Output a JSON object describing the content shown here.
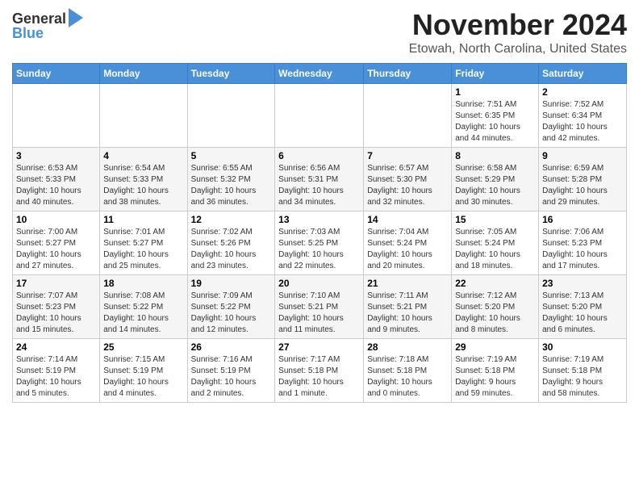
{
  "logo": {
    "text_general": "General",
    "text_blue": "Blue"
  },
  "header": {
    "month": "November 2024",
    "location": "Etowah, North Carolina, United States"
  },
  "weekdays": [
    "Sunday",
    "Monday",
    "Tuesday",
    "Wednesday",
    "Thursday",
    "Friday",
    "Saturday"
  ],
  "weeks": [
    [
      {
        "day": "",
        "info": ""
      },
      {
        "day": "",
        "info": ""
      },
      {
        "day": "",
        "info": ""
      },
      {
        "day": "",
        "info": ""
      },
      {
        "day": "",
        "info": ""
      },
      {
        "day": "1",
        "info": "Sunrise: 7:51 AM\nSunset: 6:35 PM\nDaylight: 10 hours\nand 44 minutes."
      },
      {
        "day": "2",
        "info": "Sunrise: 7:52 AM\nSunset: 6:34 PM\nDaylight: 10 hours\nand 42 minutes."
      }
    ],
    [
      {
        "day": "3",
        "info": "Sunrise: 6:53 AM\nSunset: 5:33 PM\nDaylight: 10 hours\nand 40 minutes."
      },
      {
        "day": "4",
        "info": "Sunrise: 6:54 AM\nSunset: 5:33 PM\nDaylight: 10 hours\nand 38 minutes."
      },
      {
        "day": "5",
        "info": "Sunrise: 6:55 AM\nSunset: 5:32 PM\nDaylight: 10 hours\nand 36 minutes."
      },
      {
        "day": "6",
        "info": "Sunrise: 6:56 AM\nSunset: 5:31 PM\nDaylight: 10 hours\nand 34 minutes."
      },
      {
        "day": "7",
        "info": "Sunrise: 6:57 AM\nSunset: 5:30 PM\nDaylight: 10 hours\nand 32 minutes."
      },
      {
        "day": "8",
        "info": "Sunrise: 6:58 AM\nSunset: 5:29 PM\nDaylight: 10 hours\nand 30 minutes."
      },
      {
        "day": "9",
        "info": "Sunrise: 6:59 AM\nSunset: 5:28 PM\nDaylight: 10 hours\nand 29 minutes."
      }
    ],
    [
      {
        "day": "10",
        "info": "Sunrise: 7:00 AM\nSunset: 5:27 PM\nDaylight: 10 hours\nand 27 minutes."
      },
      {
        "day": "11",
        "info": "Sunrise: 7:01 AM\nSunset: 5:27 PM\nDaylight: 10 hours\nand 25 minutes."
      },
      {
        "day": "12",
        "info": "Sunrise: 7:02 AM\nSunset: 5:26 PM\nDaylight: 10 hours\nand 23 minutes."
      },
      {
        "day": "13",
        "info": "Sunrise: 7:03 AM\nSunset: 5:25 PM\nDaylight: 10 hours\nand 22 minutes."
      },
      {
        "day": "14",
        "info": "Sunrise: 7:04 AM\nSunset: 5:24 PM\nDaylight: 10 hours\nand 20 minutes."
      },
      {
        "day": "15",
        "info": "Sunrise: 7:05 AM\nSunset: 5:24 PM\nDaylight: 10 hours\nand 18 minutes."
      },
      {
        "day": "16",
        "info": "Sunrise: 7:06 AM\nSunset: 5:23 PM\nDaylight: 10 hours\nand 17 minutes."
      }
    ],
    [
      {
        "day": "17",
        "info": "Sunrise: 7:07 AM\nSunset: 5:23 PM\nDaylight: 10 hours\nand 15 minutes."
      },
      {
        "day": "18",
        "info": "Sunrise: 7:08 AM\nSunset: 5:22 PM\nDaylight: 10 hours\nand 14 minutes."
      },
      {
        "day": "19",
        "info": "Sunrise: 7:09 AM\nSunset: 5:22 PM\nDaylight: 10 hours\nand 12 minutes."
      },
      {
        "day": "20",
        "info": "Sunrise: 7:10 AM\nSunset: 5:21 PM\nDaylight: 10 hours\nand 11 minutes."
      },
      {
        "day": "21",
        "info": "Sunrise: 7:11 AM\nSunset: 5:21 PM\nDaylight: 10 hours\nand 9 minutes."
      },
      {
        "day": "22",
        "info": "Sunrise: 7:12 AM\nSunset: 5:20 PM\nDaylight: 10 hours\nand 8 minutes."
      },
      {
        "day": "23",
        "info": "Sunrise: 7:13 AM\nSunset: 5:20 PM\nDaylight: 10 hours\nand 6 minutes."
      }
    ],
    [
      {
        "day": "24",
        "info": "Sunrise: 7:14 AM\nSunset: 5:19 PM\nDaylight: 10 hours\nand 5 minutes."
      },
      {
        "day": "25",
        "info": "Sunrise: 7:15 AM\nSunset: 5:19 PM\nDaylight: 10 hours\nand 4 minutes."
      },
      {
        "day": "26",
        "info": "Sunrise: 7:16 AM\nSunset: 5:19 PM\nDaylight: 10 hours\nand 2 minutes."
      },
      {
        "day": "27",
        "info": "Sunrise: 7:17 AM\nSunset: 5:18 PM\nDaylight: 10 hours\nand 1 minute."
      },
      {
        "day": "28",
        "info": "Sunrise: 7:18 AM\nSunset: 5:18 PM\nDaylight: 10 hours\nand 0 minutes."
      },
      {
        "day": "29",
        "info": "Sunrise: 7:19 AM\nSunset: 5:18 PM\nDaylight: 9 hours\nand 59 minutes."
      },
      {
        "day": "30",
        "info": "Sunrise: 7:19 AM\nSunset: 5:18 PM\nDaylight: 9 hours\nand 58 minutes."
      }
    ]
  ]
}
